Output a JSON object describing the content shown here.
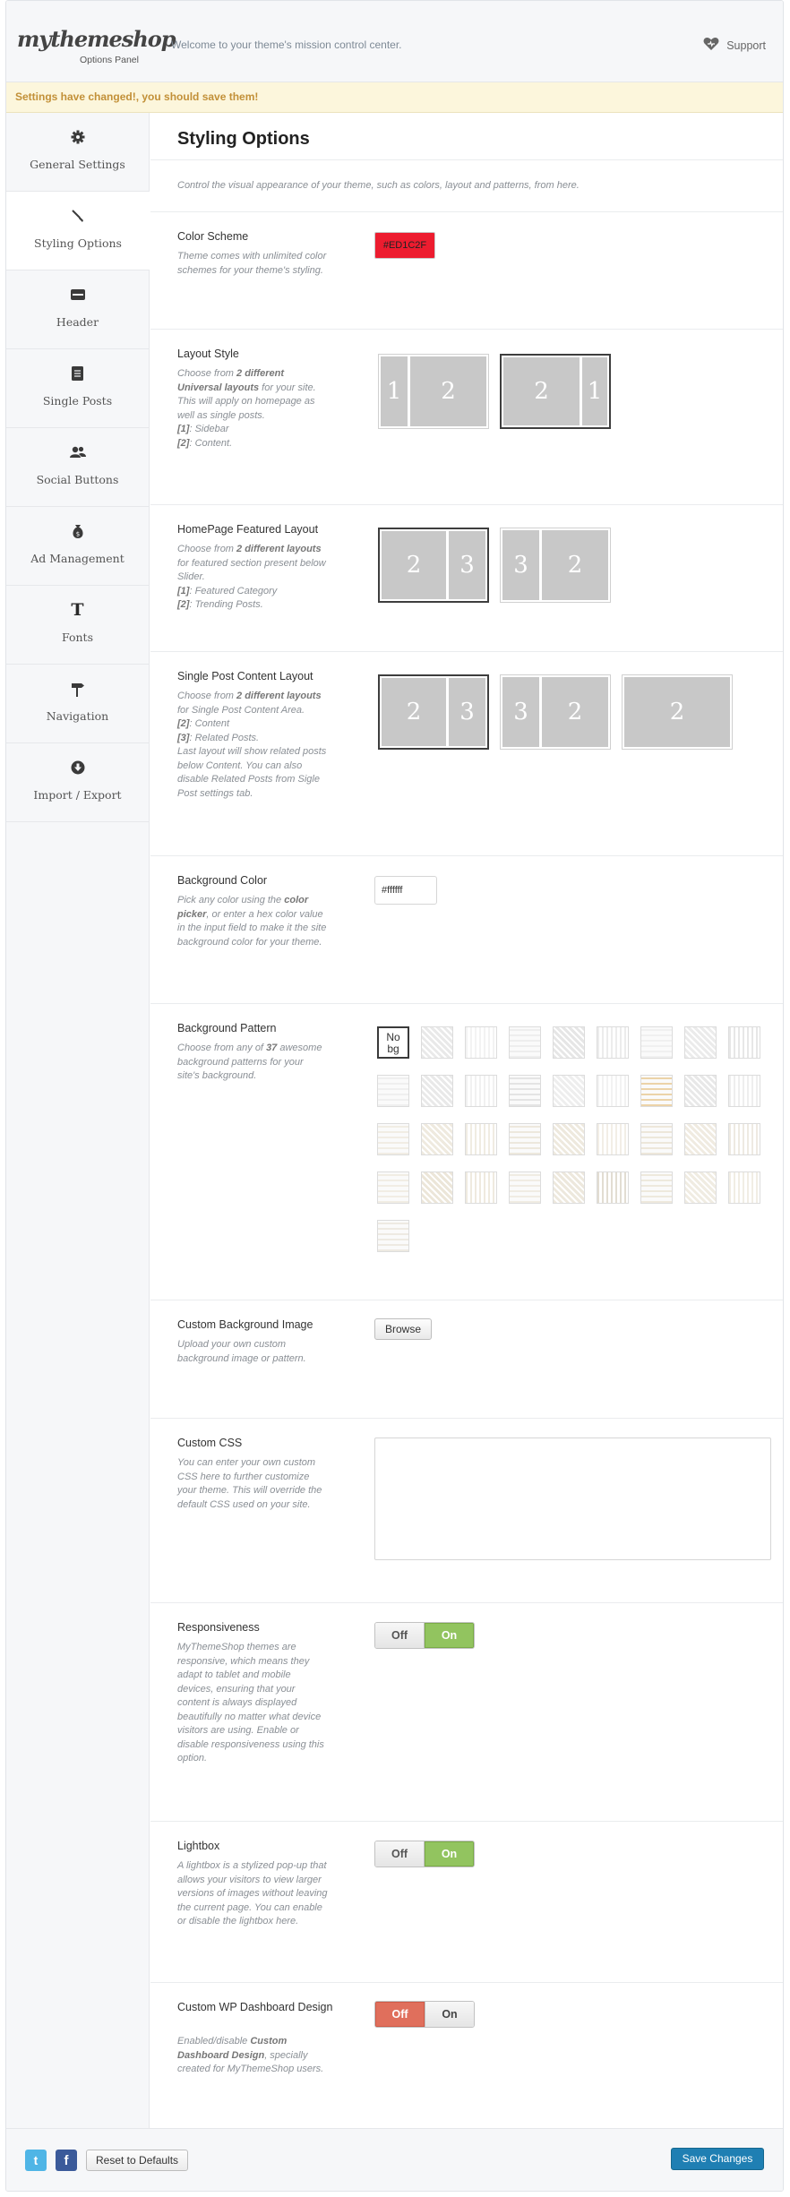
{
  "header": {
    "logo_main": "mythemeshop",
    "logo_sub": "Options Panel",
    "welcome": "Welcome to your theme's mission control center.",
    "support": "Support"
  },
  "notice": "Settings have changed!, you should save them!",
  "sidebar": {
    "items": [
      {
        "label": "General Settings",
        "icon": "gear-icon"
      },
      {
        "label": "Styling Options",
        "icon": "brush-icon"
      },
      {
        "label": "Header",
        "icon": "header-icon"
      },
      {
        "label": "Single Posts",
        "icon": "document-icon"
      },
      {
        "label": "Social Buttons",
        "icon": "users-icon"
      },
      {
        "label": "Ad Management",
        "icon": "money-bag-icon"
      },
      {
        "label": "Fonts",
        "icon": "font-icon"
      },
      {
        "label": "Navigation",
        "icon": "signpost-icon"
      },
      {
        "label": "Import / Export",
        "icon": "download-icon"
      }
    ],
    "active": "Styling Options"
  },
  "main": {
    "title": "Styling Options",
    "description": "Control the visual appearance of your theme, such as colors, layout and patterns, from here.",
    "color_scheme": {
      "title": "Color Scheme",
      "desc": "Theme comes with unlimited color schemes for your theme's styling.",
      "value": "#ED1C2F"
    },
    "layout_style": {
      "title": "Layout Style",
      "desc_a": "Choose from ",
      "desc_bold": "2 different Universal layouts",
      "desc_b": " for your site. This will apply on homepage as well as single posts.",
      "legend_1_key": "[1]",
      "legend_1": ": Sidebar",
      "legend_2_key": "[2]",
      "legend_2": ": Content.",
      "options": [
        {
          "left": "1",
          "right": "2",
          "selected": false
        },
        {
          "left": "2",
          "right": "1",
          "selected": true
        }
      ]
    },
    "homepage_layout": {
      "title": "HomePage Featured Layout",
      "desc_a": "Choose from ",
      "desc_bold": "2 different layouts",
      "desc_b": " for featured section present below Slider.",
      "legend_1_key": "[1]",
      "legend_1": ": Featured Category",
      "legend_2_key": "[2]",
      "legend_2": ": Trending Posts.",
      "options": [
        {
          "left": "2",
          "right": "3",
          "selected": true
        },
        {
          "left": "3",
          "right": "2",
          "selected": false
        }
      ]
    },
    "single_layout": {
      "title": "Single Post Content Layout",
      "desc_a": "Choose from ",
      "desc_bold": "2 different layouts",
      "desc_b": " for Single Post Content Area.",
      "legend_1_key": "[2]",
      "legend_1": ": Content",
      "legend_2_key": "[3]",
      "legend_2": ": Related Posts.",
      "desc_c": "Last layout will show related posts below Content. You can also disable Related Posts from Sigle Post settings tab.",
      "options": [
        {
          "left": "2",
          "right": "3",
          "selected": true
        },
        {
          "left": "3",
          "right": "2",
          "selected": false
        },
        {
          "left": "2",
          "right": "",
          "selected": false
        }
      ]
    },
    "background_color": {
      "title": "Background Color",
      "desc_a": "Pick any color using the ",
      "desc_bold": "color picker",
      "desc_b": ", or enter a hex color value in the input field to make it the site background color for your theme.",
      "value": "#ffffff"
    },
    "background_pattern": {
      "title": "Background Pattern",
      "desc_a": "Choose from any of ",
      "desc_bold": "37",
      "desc_b": " awesome background patterns for your site's background.",
      "no_bg_label": "No bg",
      "pattern_count": 37,
      "selected_label": "No bg"
    },
    "custom_bg_image": {
      "title": "Custom Background Image",
      "desc": "Upload your own custom background image or pattern.",
      "button": "Browse"
    },
    "custom_css": {
      "title": "Custom CSS",
      "desc": "You can enter your own custom CSS here to further customize your theme. This will override the default CSS used on your site.",
      "value": ""
    },
    "responsiveness": {
      "title": "Responsiveness",
      "desc": "MyThemeShop themes are responsive, which means they adapt to tablet and mobile devices, ensuring that your content is always displayed beautifully no matter what device visitors are using. Enable or disable responsiveness using this option.",
      "off": "Off",
      "on": "On",
      "state": "On"
    },
    "lightbox": {
      "title": "Lightbox",
      "desc": "A lightbox is a stylized pop-up that allows your visitors to view larger versions of images without leaving the current page. You can enable or disable the lightbox here.",
      "off": "Off",
      "on": "On",
      "state": "On"
    },
    "dashboard": {
      "title": "Custom WP Dashboard Design",
      "desc_a": "Enabled/disable ",
      "desc_bold": "Custom Dashboard Design",
      "desc_b": ", specially created for MyThemeShop users.",
      "off": "Off",
      "on": "On",
      "state": "Off"
    }
  },
  "footer": {
    "twitter": "t",
    "facebook": "f",
    "reset": "Reset to Defaults",
    "save": "Save Changes"
  },
  "colors": {
    "accent_blue": "#1f7fb3",
    "color_scheme": "#ED1C2F",
    "toggle_on": "#92c45f",
    "toggle_off": "#e06f5c",
    "notice_text": "#c29038"
  }
}
